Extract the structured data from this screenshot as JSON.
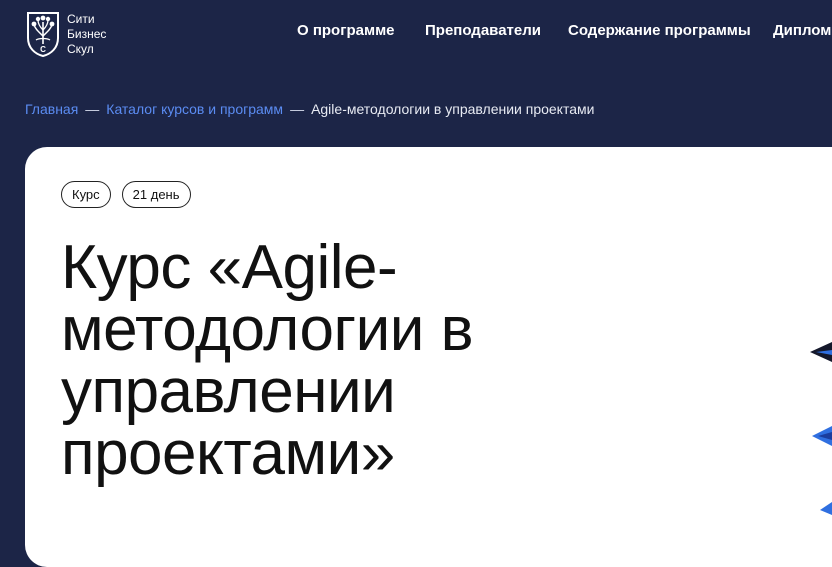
{
  "logo": {
    "lines": [
      "Сити",
      "Бизнес",
      "Скул"
    ],
    "shield_letter": "С"
  },
  "nav": {
    "items": [
      {
        "label": "О программе"
      },
      {
        "label": "Преподаватели"
      },
      {
        "label": "Содержание программы"
      },
      {
        "label": "Диплом"
      }
    ]
  },
  "breadcrumb": {
    "items": [
      {
        "label": "Главная"
      },
      {
        "label": "Каталог курсов и программ"
      }
    ],
    "separator": "—",
    "current": "Agile-методологии в управлении проектами"
  },
  "hero": {
    "tags": [
      {
        "label": "Курс"
      },
      {
        "label": "21 день"
      }
    ],
    "title_lines": [
      "Курс «Agile-",
      "методологии в",
      "управлении",
      "проектами»"
    ]
  },
  "colors": {
    "background": "#1c2547",
    "card": "#ffffff",
    "link": "#5b8cf2",
    "accent_blue": "#2f6fe0"
  }
}
